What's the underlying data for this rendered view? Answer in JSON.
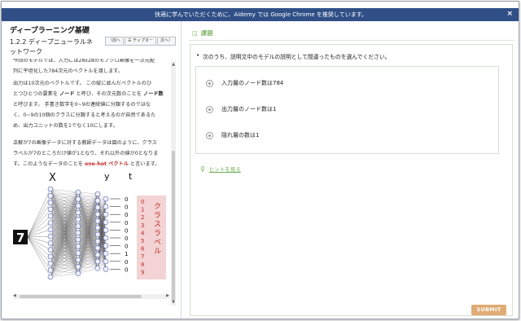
{
  "banner": {
    "text": "快適に学んでいただくために、Aidemy では Google Chrome を推奨しています。",
    "close_icon": "×"
  },
  "left": {
    "course_title": "ディープラーニング基礎",
    "section_title": "1.2.2 ディープニューラルネットワーク",
    "nav": {
      "prev": "〈前へ",
      "chapter": "☰ チャプター",
      "next": "次へ〉"
    },
    "para1_lines": [
      "今回のモデルでは、入力には28x28のモノクロ画像を一次元配",
      "列に平坦化した784次元のベクトルを渡します。"
    ],
    "para2": {
      "line1": "出力は10次元のベクトルです。 この縦に並んだベクトルのひ",
      "line2_a": "とつひとつの要素を",
      "line2_node": "ノード",
      "line2_b": "と呼び、その次元数のことを",
      "line2_count": "ノード数",
      "line3": "と呼びます。 手書き数字を0~9の連続値に分類するのではな",
      "line4": "く、0~9の10個のクラスに分類すると考えるのが自然であるた",
      "line5": "め、出力ユニットの数を1でなく10にします。"
    },
    "para3": {
      "line1": "正解が7の画像データに対する教師データは図のように、クラス",
      "line2": "ラベルが7のところだけ値が1となり、それ以外の値が0となりま",
      "line3_a": "す。このようなデータのことを",
      "line3_red": "one-hot ベクトル",
      "line3_b": "と言います。"
    },
    "diagram": {
      "label_x": "X",
      "label_y": "y",
      "label_t": "t",
      "input_digit": "7",
      "t_values": [
        "0",
        "0",
        "0",
        "0",
        "0",
        "0",
        "0",
        "1",
        "0",
        "0"
      ],
      "class_numbers": [
        "0",
        "1",
        "2",
        "3",
        "4",
        "5",
        "6",
        "7",
        "8",
        "9"
      ],
      "class_label": "クラスラベル"
    }
  },
  "task": {
    "title": "課題",
    "question": "次のうち、説明文中のモデルの説明として間違ったものを選んでください。",
    "options": [
      "入力層のノード数は784",
      "出力層のノード数は1",
      "隠れ層の数は1"
    ],
    "hint": "ヒントを見る",
    "submit": "SUBMIT"
  }
}
